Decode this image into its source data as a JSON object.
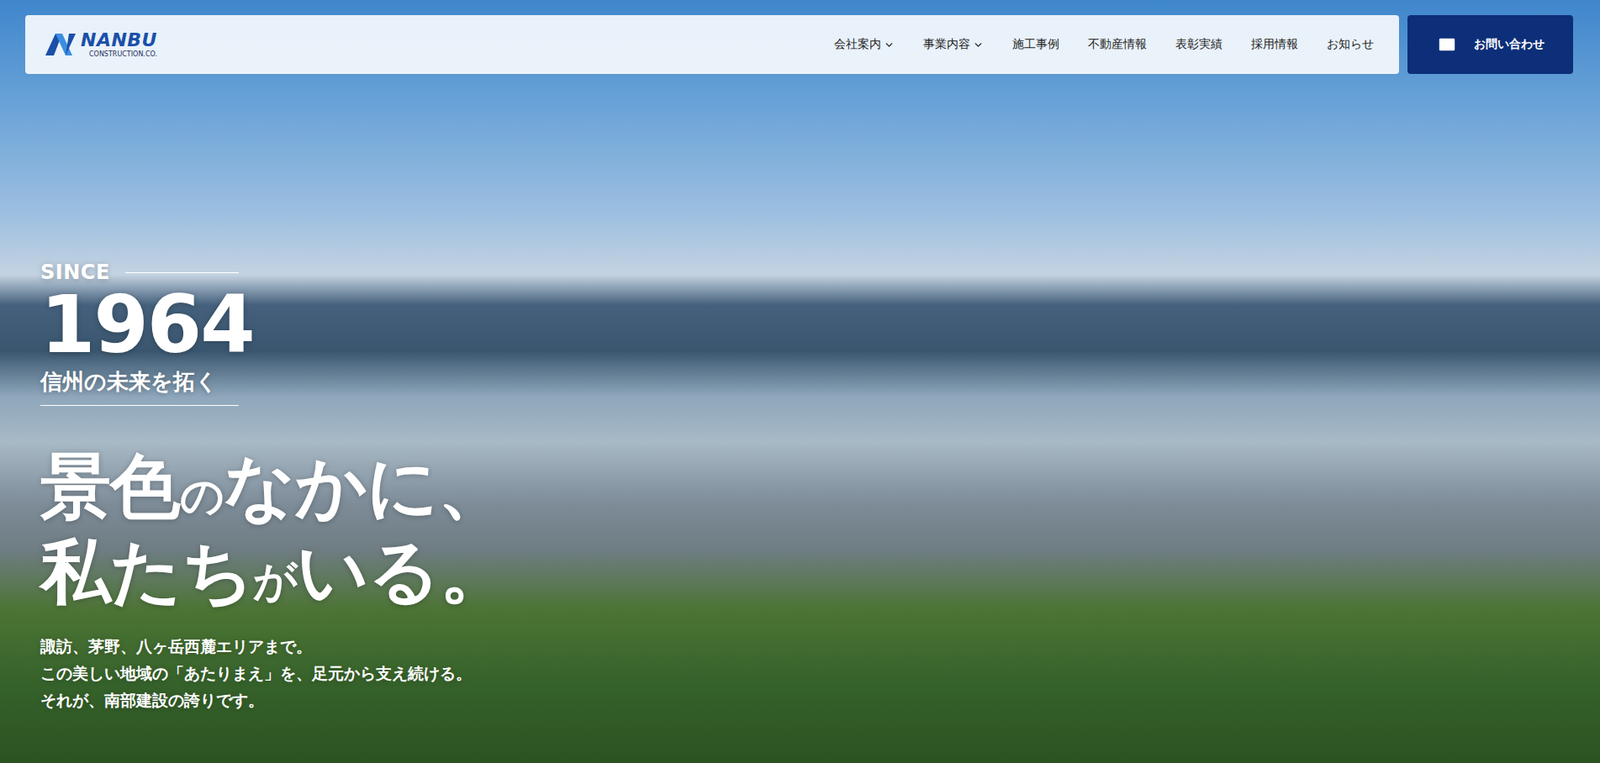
{
  "header": {
    "logo": {
      "name": "NANBU",
      "sub": "CONSTRUCTION.CO."
    },
    "nav": [
      {
        "label": "会社案内",
        "dropdown": true
      },
      {
        "label": "事業内容",
        "dropdown": true
      },
      {
        "label": "施工事例",
        "dropdown": false
      },
      {
        "label": "不動産情報",
        "dropdown": false
      },
      {
        "label": "表彰実績",
        "dropdown": false
      },
      {
        "label": "採用情報",
        "dropdown": false
      },
      {
        "label": "お知らせ",
        "dropdown": false
      }
    ],
    "contact": "お問い合わせ"
  },
  "hero": {
    "since": "SINCE",
    "year": "1964",
    "tagline": "信州の未来を拓く",
    "headline": [
      [
        {
          "text": "景色",
          "small": false
        },
        {
          "text": "の",
          "small": true
        },
        {
          "text": "なかに、",
          "small": false
        }
      ],
      [
        {
          "text": "私たち",
          "small": false
        },
        {
          "text": "が",
          "small": true
        },
        {
          "text": "いる。",
          "small": false
        }
      ]
    ],
    "body": [
      "諏訪、茅野、八ヶ岳西麓エリアまで。",
      "この美しい地域の「あたりまえ」を、足元から支え続ける。",
      "それが、南部建設の誇りです。"
    ]
  }
}
